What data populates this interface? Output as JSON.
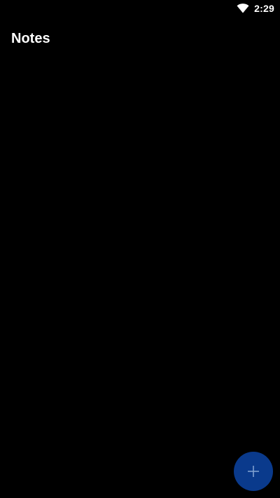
{
  "status_bar": {
    "time": "2:29",
    "wifi_icon": "wifi-icon"
  },
  "app_bar": {
    "title": "Notes"
  },
  "fab": {
    "icon": "plus-icon",
    "color": "#0a3a8c",
    "icon_color": "#7f9fd0"
  },
  "theme": {
    "background": "#000000",
    "text": "#ffffff"
  }
}
